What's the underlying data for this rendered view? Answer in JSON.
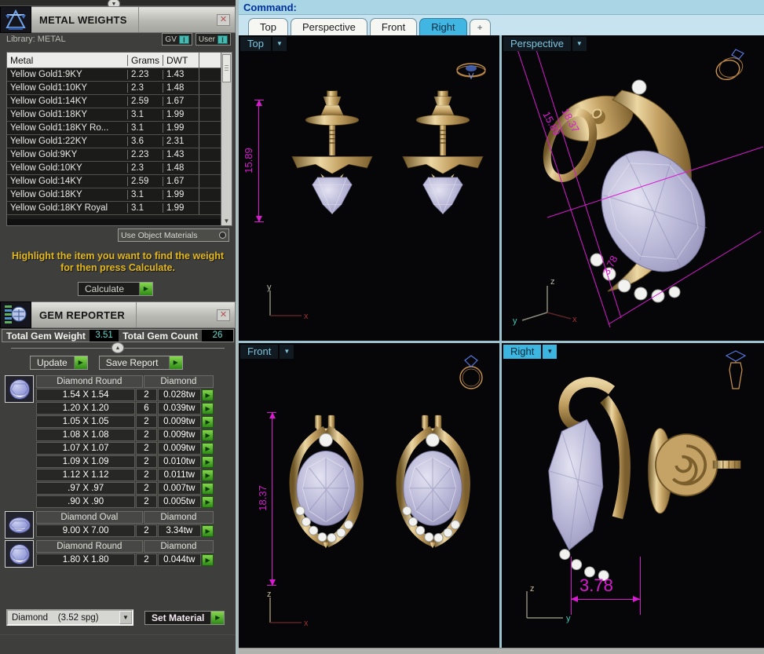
{
  "colors": {
    "magenta": "#d91ad1",
    "teal_value": "#63d9cd",
    "yellow_text": "#e3b81e",
    "green_button": "#2e8a17",
    "active_tab": "#41b6e2",
    "command_text": "#00309c",
    "gold": "#c9a25e",
    "gem": "#b7b5d6"
  },
  "left_panel": {
    "metal_weights": {
      "title": "METAL WEIGHTS",
      "close_glyph": "✕",
      "library_label": "Library: METAL",
      "gv_label": "GV",
      "user_label": "User",
      "toggle_glyph": "I",
      "table": {
        "columns": [
          "Metal",
          "Grams",
          "DWT"
        ],
        "rows": [
          [
            "Yellow Gold1:9KY",
            "2.23",
            "1.43"
          ],
          [
            "Yellow Gold1:10KY",
            "2.3",
            "1.48"
          ],
          [
            "Yellow Gold1:14KY",
            "2.59",
            "1.67"
          ],
          [
            "Yellow Gold1:18KY",
            "3.1",
            "1.99"
          ],
          [
            "Yellow Gold1:18KY Ro...",
            "3.1",
            "1.99"
          ],
          [
            "Yellow Gold1:22KY",
            "3.6",
            "2.31"
          ],
          [
            "Yellow Gold:9KY",
            "2.23",
            "1.43"
          ],
          [
            "Yellow Gold:10KY",
            "2.3",
            "1.48"
          ],
          [
            "Yellow Gold:14KY",
            "2.59",
            "1.67"
          ],
          [
            "Yellow Gold:18KY",
            "3.1",
            "1.99"
          ],
          [
            "Yellow Gold:18KY Royal",
            "3.1",
            "1.99"
          ]
        ]
      },
      "use_object_materials_label": "Use Object Materials",
      "instruction_line1": "Highlight the item you want to find the weight",
      "instruction_line2": "for then press Calculate.",
      "calculate_label": "Calculate"
    },
    "gem_reporter": {
      "title": "GEM REPORTER",
      "close_glyph": "✕",
      "total_weight_label": "Total Gem Weight",
      "total_weight_value": "3.51",
      "total_count_label": "Total Gem Count",
      "total_count_value": "26",
      "update_label": "Update",
      "save_report_label": "Save Report",
      "groups": [
        {
          "type": "Diamond Round",
          "material": "Diamond",
          "rows": [
            {
              "size": "1.54 X 1.54",
              "count": "2",
              "weight": "0.028tw"
            },
            {
              "size": "1.20 X 1.20",
              "count": "6",
              "weight": "0.039tw"
            },
            {
              "size": "1.05 X 1.05",
              "count": "2",
              "weight": "0.009tw"
            },
            {
              "size": "1.08 X 1.08",
              "count": "2",
              "weight": "0.009tw"
            },
            {
              "size": "1.07 X 1.07",
              "count": "2",
              "weight": "0.009tw"
            },
            {
              "size": "1.09 X 1.09",
              "count": "2",
              "weight": "0.010tw"
            },
            {
              "size": "1.12 X 1.12",
              "count": "2",
              "weight": "0.011tw"
            },
            {
              "size": ".97 X .97",
              "count": "2",
              "weight": "0.007tw"
            },
            {
              "size": ".90 X .90",
              "count": "2",
              "weight": "0.005tw"
            }
          ]
        },
        {
          "type": "Diamond Oval",
          "material": "Diamond",
          "rows": [
            {
              "size": "9.00 X 7.00",
              "count": "2",
              "weight": "3.34tw"
            }
          ]
        },
        {
          "type": "Diamond Round",
          "material": "Diamond",
          "rows": [
            {
              "size": "1.80 X 1.80",
              "count": "2",
              "weight": "0.044tw"
            }
          ]
        }
      ],
      "material_select_value": "Diamond    (3.52 spg)",
      "set_material_label": "Set Material"
    }
  },
  "command_bar": {
    "label": "Command:"
  },
  "view_tabs": {
    "items": [
      {
        "label": "Top"
      },
      {
        "label": "Perspective"
      },
      {
        "label": "Front"
      },
      {
        "label": "Right"
      },
      {
        "label": "+"
      }
    ]
  },
  "viewports": {
    "top": {
      "label": "Top",
      "dim": "15.89",
      "axis_v": "y",
      "axis_h": "x"
    },
    "perspective": {
      "label": "Perspective",
      "dim1": "15.89",
      "dim2": "18.37",
      "dim3": "3.78",
      "axis_v": "z",
      "axis_l": "y",
      "axis_h": "x"
    },
    "front": {
      "label": "Front",
      "dim": "18.37",
      "axis_v": "z",
      "axis_h": "x"
    },
    "right": {
      "label": "Right",
      "dim": "3.78",
      "axis_v": "z",
      "axis_h": "y"
    }
  }
}
